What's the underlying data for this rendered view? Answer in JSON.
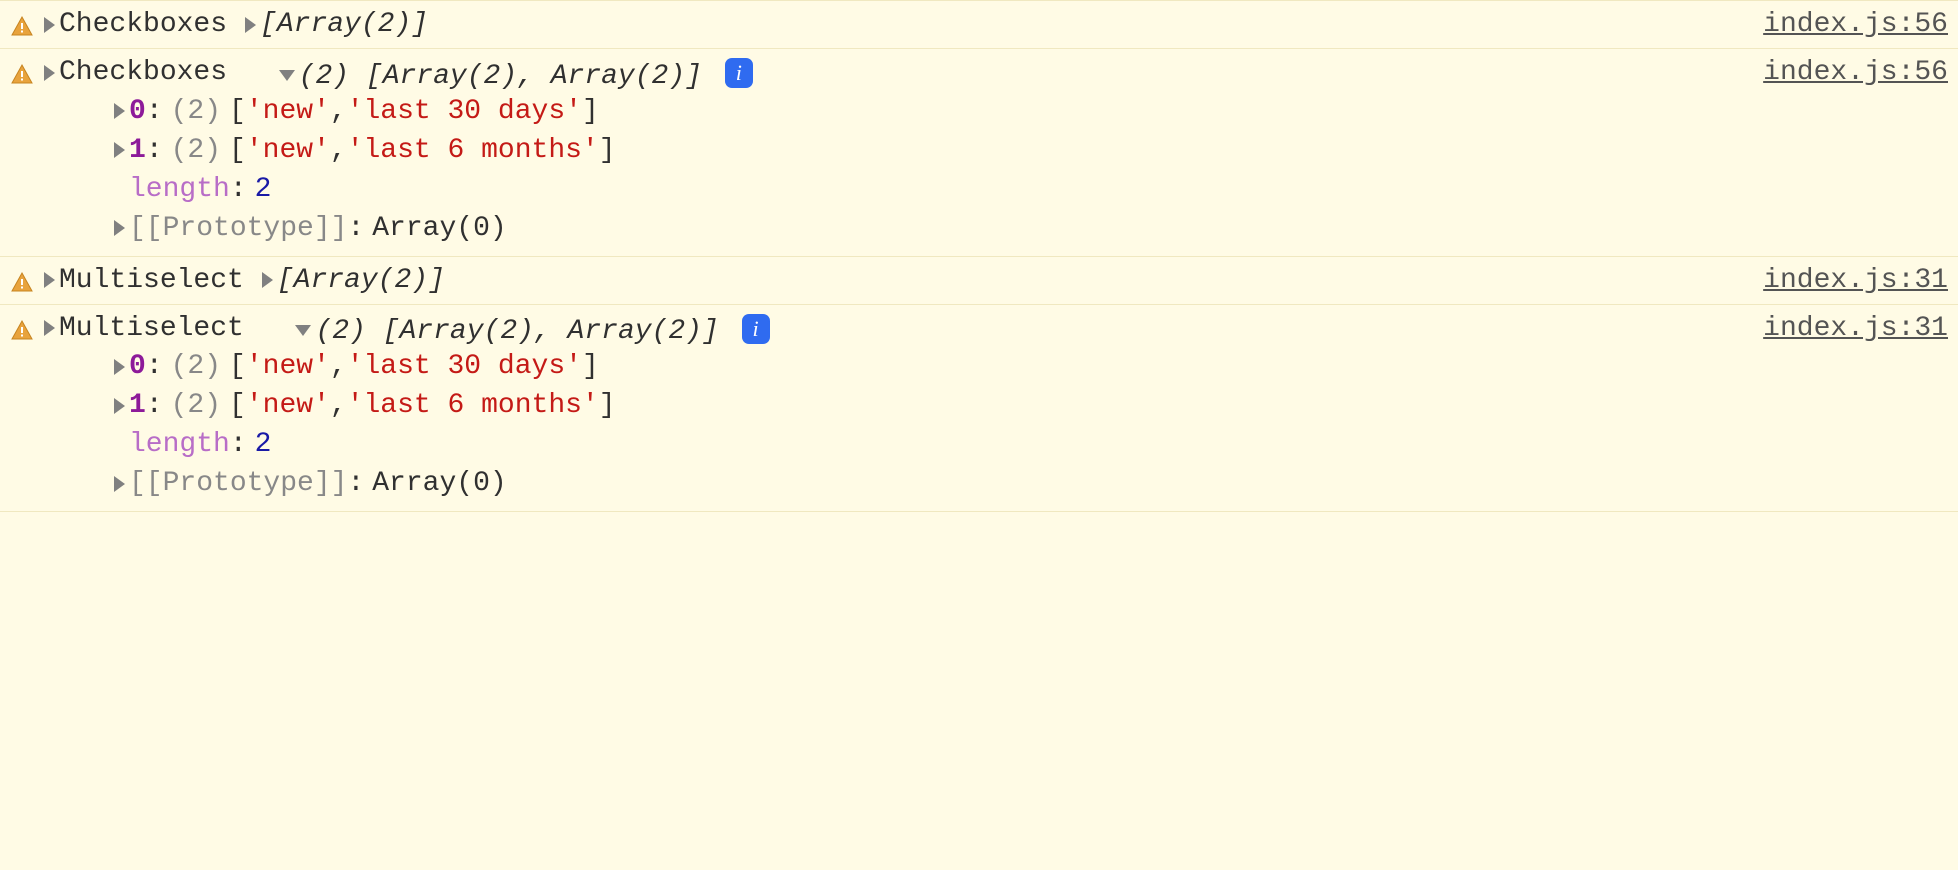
{
  "logs": [
    {
      "label": "Checkboxes",
      "expanded": false,
      "summary": "[Array(2)]",
      "source": "index.js:56"
    },
    {
      "label": "Checkboxes",
      "expanded": true,
      "summary_count": "(2)",
      "summary_body": "[Array(2), Array(2)]",
      "source": "index.js:56",
      "children": [
        {
          "key": "0",
          "preview_count": "(2)",
          "items": [
            "'new'",
            "'last 30 days'"
          ]
        },
        {
          "key": "1",
          "preview_count": "(2)",
          "items": [
            "'new'",
            "'last 6 months'"
          ]
        }
      ],
      "length_key": "length",
      "length_value": "2",
      "prototype_key": "[[Prototype]]",
      "prototype_value": "Array(0)"
    },
    {
      "label": "Multiselect",
      "expanded": false,
      "summary": "[Array(2)]",
      "source": "index.js:31"
    },
    {
      "label": "Multiselect",
      "expanded": true,
      "summary_count": "(2)",
      "summary_body": "[Array(2), Array(2)]",
      "source": "index.js:31",
      "children": [
        {
          "key": "0",
          "preview_count": "(2)",
          "items": [
            "'new'",
            "'last 30 days'"
          ]
        },
        {
          "key": "1",
          "preview_count": "(2)",
          "items": [
            "'new'",
            "'last 6 months'"
          ]
        }
      ],
      "length_key": "length",
      "length_value": "2",
      "prototype_key": "[[Prototype]]",
      "prototype_value": "Array(0)"
    }
  ]
}
